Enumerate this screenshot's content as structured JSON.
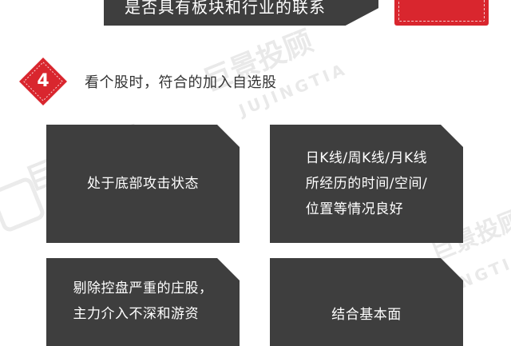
{
  "top_banner": {
    "text": "是否具有板块和行业的联系"
  },
  "step": {
    "number": "4",
    "text": "看个股时，符合的加入自选股"
  },
  "watermark": {
    "brand": "巨景投顾",
    "latin": "JUJINGTIA"
  },
  "cards": [
    {
      "lines": [
        "处于底部攻击状态"
      ]
    },
    {
      "lines": [
        "日K线/周K线/月K线",
        "所经历的时间/空间/",
        "位置等情况良好"
      ]
    },
    {
      "lines": [
        "剔除控盘严重的庄股，",
        "主力介入不深和游资"
      ]
    },
    {
      "lines": [
        "结合基本面"
      ]
    }
  ],
  "colors": {
    "card": "#3e3e3e",
    "accent_red": "#d9262e",
    "text": "#333333"
  }
}
